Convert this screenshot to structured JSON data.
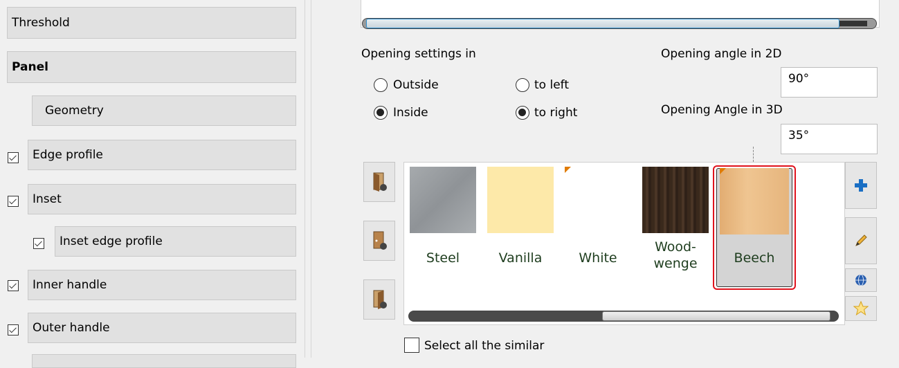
{
  "left_panel": {
    "items": [
      {
        "label": "Threshold",
        "checked": null
      },
      {
        "label": "Panel",
        "checked": null,
        "bold": true
      },
      {
        "label": "Geometry",
        "checked": null
      },
      {
        "label": "Edge profile",
        "checked": true
      },
      {
        "label": "Inset",
        "checked": true
      },
      {
        "label": "Inset edge profile",
        "checked": true
      },
      {
        "label": "Inner handle",
        "checked": true
      },
      {
        "label": "Outer handle",
        "checked": true
      }
    ]
  },
  "opening": {
    "settings_label": "Opening settings in",
    "outside_label": "Outside",
    "inside_label": "Inside",
    "to_left_label": "to left",
    "to_right_label": "to right",
    "selected_side": "Inside",
    "selected_direction": "to right",
    "angle2d_label": "Opening angle in 2D",
    "angle2d_value": "90°",
    "angle3d_label": "Opening Angle in 3D",
    "angle3d_value": "35°"
  },
  "materials": [
    {
      "name": "Steel",
      "color": "#9ea2a6"
    },
    {
      "name": "Vanilla",
      "color": "#fde9a9"
    },
    {
      "name": "White",
      "color": "#ffffff"
    },
    {
      "name": "Wood-\nwenge",
      "color": "#3b2a1e"
    },
    {
      "name": "Beech",
      "color": "#e8b77e",
      "selected": true
    }
  ],
  "select_all_similar_label": "Select all the similar",
  "colors": {
    "accent": "#2c8ecf",
    "selection": "#e0121c",
    "tag": "#e07b00"
  }
}
